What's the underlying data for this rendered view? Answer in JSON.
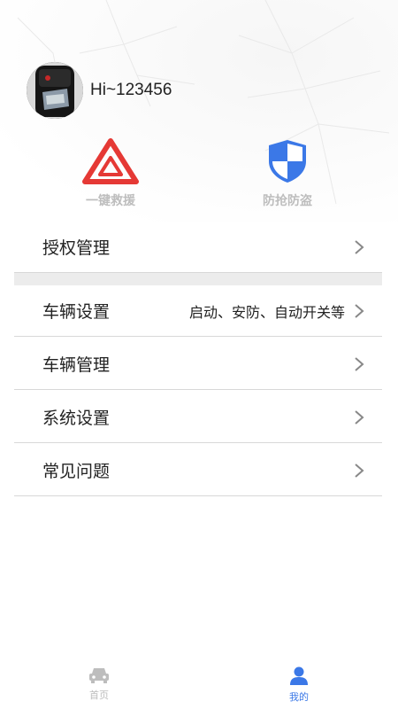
{
  "profile": {
    "username": "Hi~123456"
  },
  "quick_actions": [
    {
      "label": "一键救援",
      "icon": "warning-triangle-icon",
      "color": "#e53935"
    },
    {
      "label": "防抢防盗",
      "icon": "shield-icon",
      "color": "#3b78e7"
    }
  ],
  "menu": [
    {
      "label": "授权管理",
      "hint": ""
    },
    {
      "label": "车辆设置",
      "hint": "启动、安防、自动开关等"
    },
    {
      "label": "车辆管理",
      "hint": ""
    },
    {
      "label": "系统设置",
      "hint": ""
    },
    {
      "label": "常见问题",
      "hint": ""
    }
  ],
  "tabbar": {
    "home_label": "首页",
    "mine_label": "我的",
    "active_color": "#3b78e7",
    "inactive_color": "#bdbdbd"
  }
}
